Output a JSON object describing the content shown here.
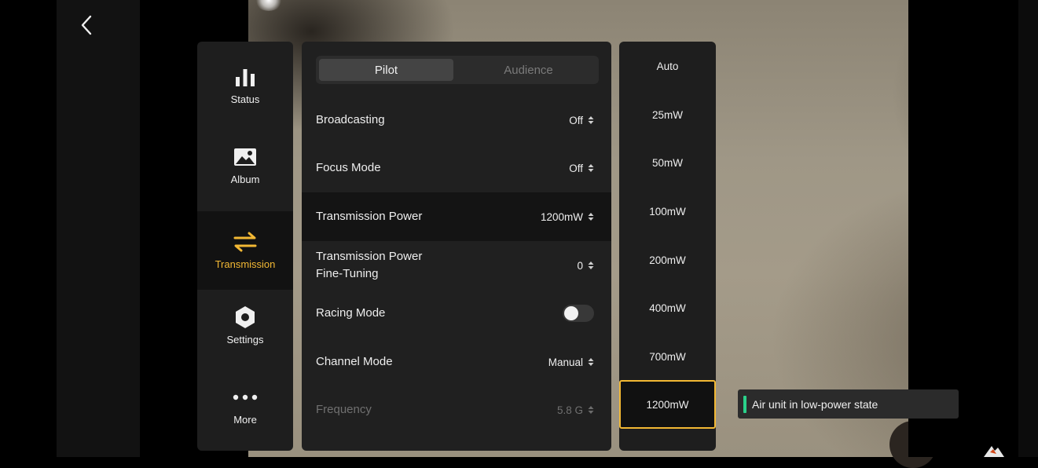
{
  "nav": {
    "items": [
      {
        "label": "Status",
        "icon": "bar-chart-icon",
        "active": false
      },
      {
        "label": "Album",
        "icon": "image-icon",
        "active": false
      },
      {
        "label": "Transmission",
        "icon": "swap-arrows-icon",
        "active": true
      },
      {
        "label": "Settings",
        "icon": "hexagon-gear-icon",
        "active": false
      },
      {
        "label": "More",
        "icon": "more-dots-icon",
        "active": false
      }
    ]
  },
  "tabs": {
    "pilot": "Pilot",
    "audience": "Audience",
    "active": "Pilot"
  },
  "settings": {
    "broadcasting": {
      "name": "Broadcasting",
      "value": "Off"
    },
    "focus_mode": {
      "name": "Focus Mode",
      "value": "Off"
    },
    "transmission_power": {
      "name": "Transmission Power",
      "value": "1200mW"
    },
    "fine_tuning": {
      "name_line1": "Transmission Power",
      "name_line2": "Fine-Tuning",
      "value": "0"
    },
    "racing_mode": {
      "name": "Racing Mode",
      "enabled": false
    },
    "channel_mode": {
      "name": "Channel Mode",
      "value": "Manual"
    },
    "frequency": {
      "name": "Frequency",
      "value": "5.8 G"
    }
  },
  "power_options": {
    "items": [
      "Auto",
      "25mW",
      "50mW",
      "100mW",
      "200mW",
      "400mW",
      "700mW",
      "1200mW"
    ],
    "selected": "1200mW"
  },
  "toast": {
    "text": "Air unit in low-power state"
  },
  "colors": {
    "accent": "#f2b834",
    "toast_bar": "#2ad18a",
    "panel_bg": "#202020"
  }
}
